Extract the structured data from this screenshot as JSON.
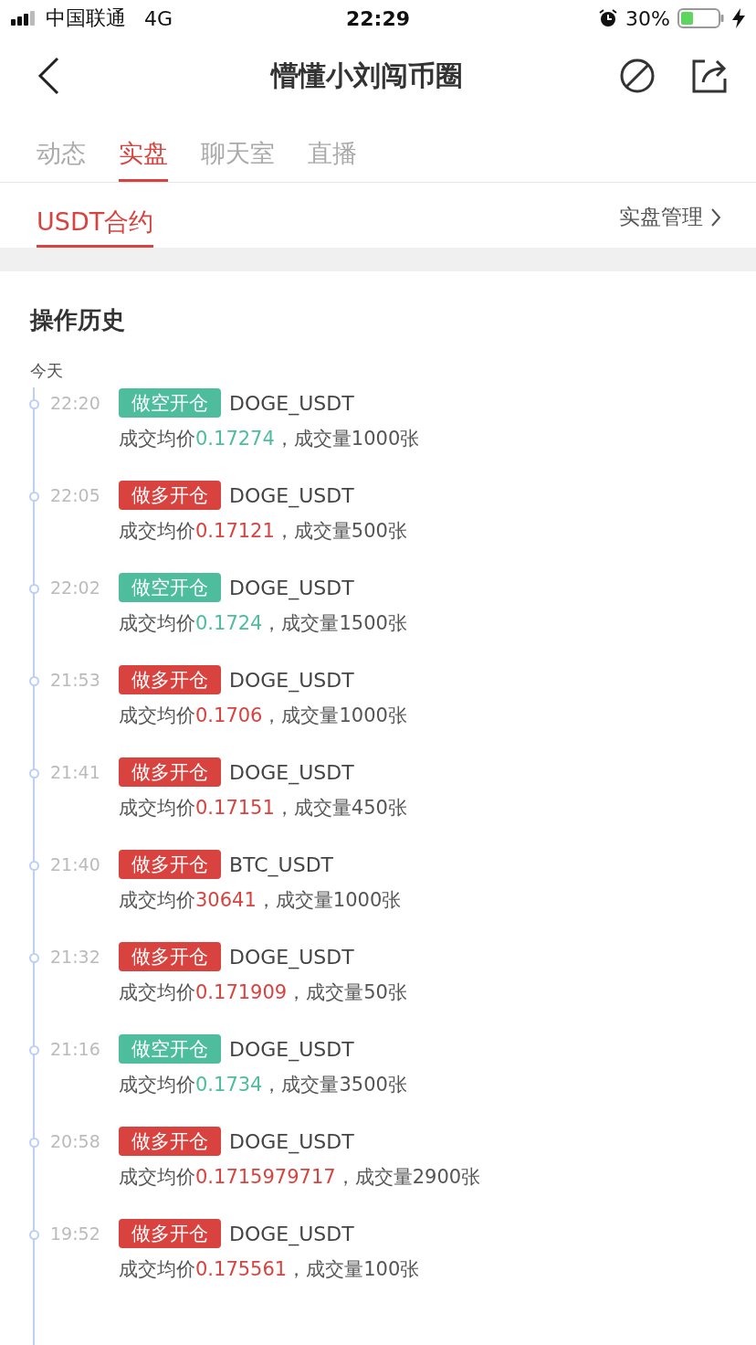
{
  "status_bar": {
    "carrier": "中国联通",
    "network": "4G",
    "time": "22:29",
    "battery": "30%"
  },
  "header": {
    "title": "懵懂小刘闯币圈"
  },
  "tabs": [
    {
      "label": "动态",
      "selected": false
    },
    {
      "label": "实盘",
      "selected": true
    },
    {
      "label": "聊天室",
      "selected": false
    },
    {
      "label": "直播",
      "selected": false
    }
  ],
  "sub_tabs": [
    {
      "label": "USDT合约",
      "selected": true
    }
  ],
  "manage_link": "实盘管理",
  "section_title": "操作历史",
  "day_label": "今天",
  "history": [
    {
      "time": "22:20",
      "kind": "short",
      "tag": "做空开仓",
      "pair": "DOGE_USDT",
      "price_label": "成交均价",
      "price": "0.17274",
      "volume": "，成交量1000张"
    },
    {
      "time": "22:05",
      "kind": "long",
      "tag": "做多开仓",
      "pair": "DOGE_USDT",
      "price_label": "成交均价",
      "price": "0.17121",
      "volume": "，成交量500张"
    },
    {
      "time": "22:02",
      "kind": "short",
      "tag": "做空开仓",
      "pair": "DOGE_USDT",
      "price_label": "成交均价",
      "price": "0.1724",
      "volume": "，成交量1500张"
    },
    {
      "time": "21:53",
      "kind": "long",
      "tag": "做多开仓",
      "pair": "DOGE_USDT",
      "price_label": "成交均价",
      "price": "0.1706",
      "volume": "，成交量1000张"
    },
    {
      "time": "21:41",
      "kind": "long",
      "tag": "做多开仓",
      "pair": "DOGE_USDT",
      "price_label": "成交均价",
      "price": "0.17151",
      "volume": "，成交量450张"
    },
    {
      "time": "21:40",
      "kind": "long",
      "tag": "做多开仓",
      "pair": "BTC_USDT",
      "price_label": "成交均价",
      "price": "30641",
      "volume": "，成交量1000张"
    },
    {
      "time": "21:32",
      "kind": "long",
      "tag": "做多开仓",
      "pair": "DOGE_USDT",
      "price_label": "成交均价",
      "price": "0.171909",
      "volume": "，成交量50张"
    },
    {
      "time": "21:16",
      "kind": "short",
      "tag": "做空开仓",
      "pair": "DOGE_USDT",
      "price_label": "成交均价",
      "price": "0.1734",
      "volume": "，成交量3500张"
    },
    {
      "time": "20:58",
      "kind": "long",
      "tag": "做多开仓",
      "pair": "DOGE_USDT",
      "price_label": "成交均价",
      "price": "0.1715979717",
      "volume": "，成交量2900张"
    },
    {
      "time": "19:52",
      "kind": "long",
      "tag": "做多开仓",
      "pair": "DOGE_USDT",
      "price_label": "成交均价",
      "price": "0.175561",
      "volume": "，成交量100张"
    }
  ]
}
